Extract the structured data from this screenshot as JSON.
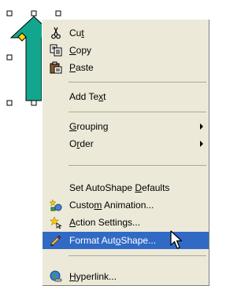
{
  "menu": {
    "items": [
      {
        "id": "cut",
        "pre": "Cu",
        "key": "t",
        "post": "",
        "icon": "scissors-icon"
      },
      {
        "id": "copy",
        "pre": "",
        "key": "C",
        "post": "opy",
        "icon": "copy-icon"
      },
      {
        "id": "paste",
        "pre": "",
        "key": "P",
        "post": "aste",
        "icon": "clipboard-paste-icon"
      },
      {
        "id": "add-text",
        "pre": "Add Te",
        "key": "x",
        "post": "t",
        "icon": ""
      },
      {
        "id": "grouping",
        "pre": "",
        "key": "G",
        "post": "rouping",
        "icon": "",
        "submenu": true
      },
      {
        "id": "order",
        "pre": "O",
        "key": "r",
        "post": "der",
        "icon": "",
        "submenu": true
      },
      {
        "id": "set-autoshape-defaults",
        "pre": "Set AutoShape ",
        "key": "D",
        "post": "efaults",
        "icon": ""
      },
      {
        "id": "custom-animation",
        "pre": "Custo",
        "key": "m",
        "post": " Animation...",
        "icon": "custom-animation-icon"
      },
      {
        "id": "action-settings",
        "pre": "",
        "key": "A",
        "post": "ction Settings...",
        "icon": "action-settings-icon"
      },
      {
        "id": "format-autoshape",
        "pre": "Format Aut",
        "key": "o",
        "post": "Shape...",
        "icon": "format-autoshape-icon",
        "highlighted": true
      },
      {
        "id": "hyperlink",
        "pre": "",
        "key": "H",
        "post": "yperlink...",
        "icon": "hyperlink-globe-icon"
      }
    ]
  },
  "colors": {
    "shape_fill": "#13a68e",
    "shape_outline": "#000000",
    "menu_bg": "#ece9d8",
    "highlight": "#316ac5",
    "adjust_handle": "#ffd700"
  }
}
